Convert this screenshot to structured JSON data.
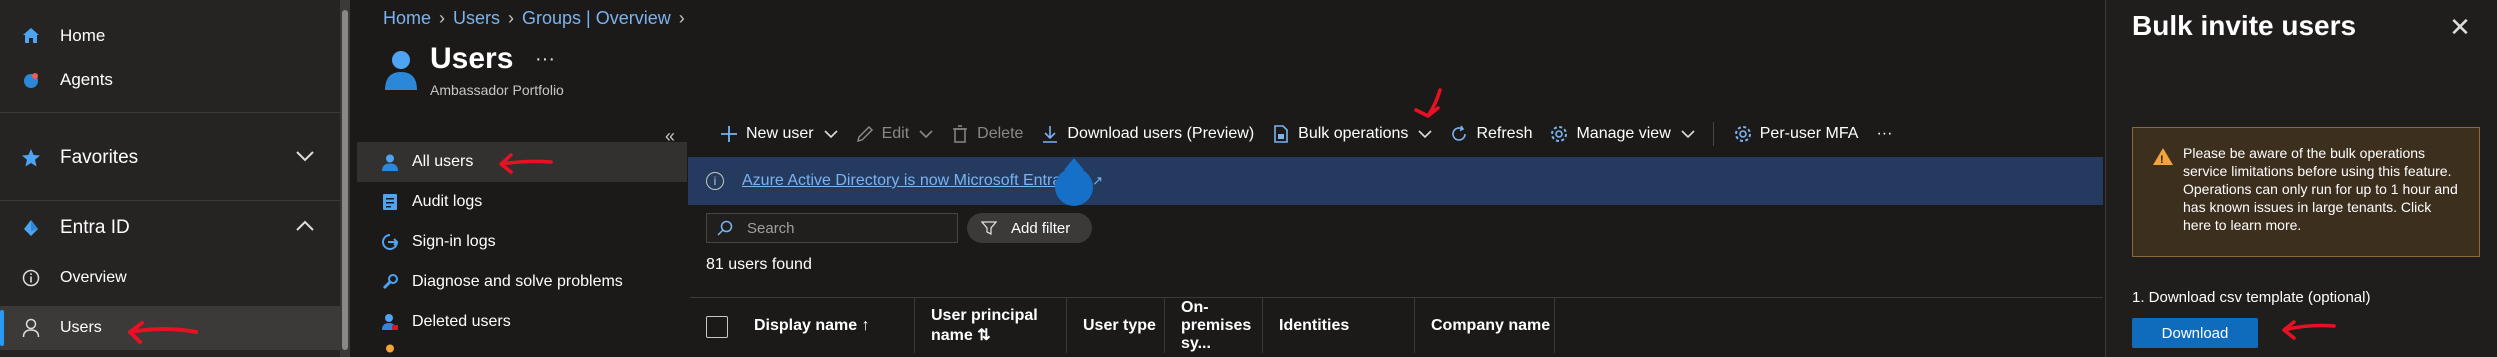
{
  "leftnav": {
    "home": "Home",
    "agents": "Agents",
    "favorites": "Favorites",
    "entra": "Entra ID",
    "overview": "Overview",
    "users": "Users"
  },
  "breadcrumb": [
    "Home",
    "Users",
    "Groups | Overview"
  ],
  "page": {
    "title": "Users",
    "more": "···",
    "subtitle": "Ambassador Portfolio"
  },
  "submenu": {
    "collapse": "«",
    "items": [
      "All users",
      "Audit logs",
      "Sign-in logs",
      "Diagnose and solve problems",
      "Deleted users"
    ]
  },
  "toolbar": {
    "new_user": "New user",
    "edit": "Edit",
    "delete": "Delete",
    "download_users": "Download users (Preview)",
    "bulk_operations": "Bulk operations",
    "refresh": "Refresh",
    "manage_view": "Manage view",
    "per_user_mfa": "Per-user MFA",
    "more": "···"
  },
  "banner": {
    "text": "Azure Active Directory is now Microsoft Entra ID."
  },
  "search": {
    "placeholder": "Search"
  },
  "filter": {
    "label": "Add filter"
  },
  "count": "81 users found",
  "table": {
    "columns": [
      "Display name ↑",
      "User principal name ⇅",
      "User type",
      "On-premises sy...",
      "Identities",
      "Company name"
    ]
  },
  "panel": {
    "title": "Bulk invite users",
    "close": "✕",
    "warning": "Please be aware of the bulk operations service limitations before using this feature. Operations can only run for up to 1 hour and has known issues in large tenants. Click here to learn more.",
    "step1": "1. Download csv template (optional)",
    "download": "Download"
  },
  "colors": {
    "accent": "#0f6cbd",
    "link": "#7ab3f0",
    "annotation": "#e81123",
    "warning": "#f2a33a"
  }
}
